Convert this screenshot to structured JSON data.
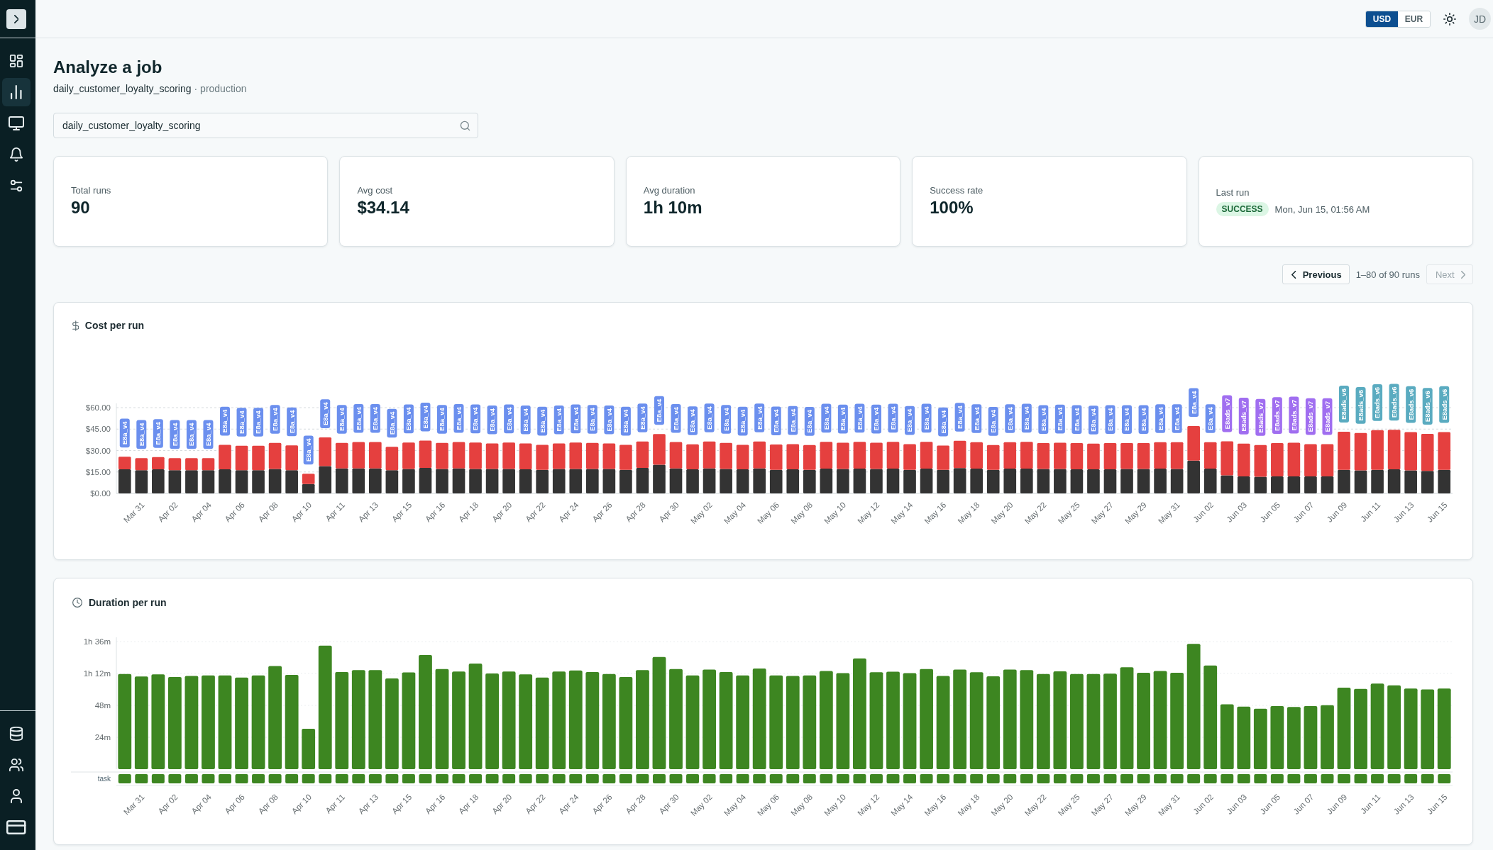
{
  "sidebar": {
    "items": [
      {
        "selected": false
      },
      {
        "selected": true
      },
      {
        "selected": false
      },
      {
        "selected": false
      },
      {
        "selected": false
      }
    ],
    "bottom_items": [
      {
        "selected": false
      },
      {
        "selected": false
      },
      {
        "selected": false
      },
      {
        "selected": false
      }
    ]
  },
  "header": {
    "currency": [
      {
        "label": "USD",
        "selected": true
      },
      {
        "label": "EUR",
        "selected": false
      }
    ],
    "avatar": "JD"
  },
  "page": {
    "title": "Analyze a job",
    "job": "daily_customer_loyalty_scoring",
    "environment": "· production"
  },
  "search": {
    "value": "daily_customer_loyalty_scoring"
  },
  "stats": [
    {
      "kind": "metric",
      "label": "Total runs",
      "value": "90"
    },
    {
      "kind": "metric",
      "label": "Avg cost",
      "value": "$34.14"
    },
    {
      "kind": "metric",
      "label": "Avg duration",
      "value": "1h 10m"
    },
    {
      "kind": "metric",
      "label": "Success rate",
      "value": "100%"
    },
    {
      "kind": "last_run",
      "label": "Last run",
      "status": "SUCCESS",
      "time": "Mon, Jun 15, 01:56 AM"
    }
  ],
  "pagination": {
    "previous": {
      "label": "Previous",
      "disabled": false
    },
    "range": "1–80 of 90 runs",
    "next": {
      "label": "Next",
      "disabled": true
    }
  },
  "cost_chart": {
    "title": "Cost per run",
    "chart_data": {
      "type": "bar",
      "stacked": true,
      "grid": true,
      "categories": [
        null,
        "Mar 31",
        null,
        "Apr 02",
        null,
        "Apr 04",
        null,
        "Apr 06",
        null,
        "Apr 08",
        null,
        "Apr 10",
        null,
        "Apr 11",
        null,
        "Apr 13",
        null,
        "Apr 15",
        null,
        "Apr 16",
        null,
        "Apr 18",
        null,
        "Apr 20",
        null,
        "Apr 22",
        null,
        "Apr 24",
        null,
        "Apr 26",
        null,
        "Apr 28",
        null,
        "Apr 30",
        null,
        "May 02",
        null,
        "May 04",
        null,
        "May 06",
        null,
        "May 08",
        null,
        "May 10",
        null,
        "May 12",
        null,
        "May 14",
        null,
        "May 16",
        null,
        "May 18",
        null,
        "May 20",
        null,
        "May 22",
        null,
        "May 25",
        null,
        "May 27",
        null,
        "May 29",
        null,
        "May 31",
        null,
        "Jun 02",
        null,
        "Jun 03",
        null,
        "Jun 05",
        null,
        "Jun 07",
        null,
        "Jun 09",
        null,
        "Jun 11",
        null,
        "Jun 13",
        null,
        "Jun 15"
      ],
      "ylim": [
        0,
        60
      ],
      "yticks": [
        {
          "value": 0,
          "label": "$0.00"
        },
        {
          "value": 15,
          "label": "$15.00"
        },
        {
          "value": 30,
          "label": "$30.00"
        },
        {
          "value": 45,
          "label": "$45.00"
        },
        {
          "value": 60,
          "label": "$60.00"
        }
      ],
      "series": [
        {
          "color": "#333333",
          "values": [
            16.8,
            16.2,
            16.8,
            16.2,
            16.2,
            16.2,
            16.8,
            16.2,
            16.2,
            17.1,
            16.2,
            6.6,
            19.1,
            17.5,
            17.5,
            17.5,
            16.2,
            17.1,
            17.8,
            17.1,
            17.5,
            17.1,
            17.1,
            17.1,
            16.8,
            16.5,
            17.1,
            17.1,
            17.1,
            17.1,
            16.5,
            17.8,
            20.1,
            17.5,
            16.8,
            17.5,
            17.1,
            16.8,
            17.5,
            16.5,
            16.8,
            16.5,
            17.4,
            17.1,
            17.4,
            17.1,
            17.4,
            16.5,
            17.4,
            16.5,
            17.7,
            17.4,
            16.5,
            17.4,
            17.4,
            17.1,
            17.1,
            16.8,
            16.8,
            16.8,
            17.1,
            17.1,
            17.4,
            17.1,
            22.9,
            17.4,
            12.6,
            11.9,
            11.6,
            11.9,
            11.9,
            11.9,
            11.9,
            16.5,
            16.1,
            16.5,
            16.8,
            16.1,
            15.8,
            16.5
          ]
        },
        {
          "color": "#e5403f",
          "values": [
            8.9,
            8.5,
            8.6,
            8.5,
            8.5,
            8.5,
            17.2,
            17.1,
            17.1,
            18.2,
            17.4,
            7.2,
            20.1,
            17.8,
            18.4,
            18.4,
            16.4,
            18.5,
            19.1,
            18.2,
            18.4,
            18.5,
            17.8,
            18.5,
            18.1,
            17.5,
            17.8,
            18.5,
            18.2,
            17.8,
            17.5,
            18.5,
            21.4,
            18.4,
            17.5,
            18.8,
            18.2,
            17.2,
            18.8,
            17.7,
            17.7,
            17.4,
            18.7,
            18.4,
            18.7,
            18.4,
            18.7,
            18,
            18.7,
            17,
            19.1,
            18.4,
            17.4,
            18.4,
            18.7,
            18.1,
            18.4,
            18.4,
            18,
            18.4,
            18.1,
            18.1,
            18.4,
            18.7,
            24.2,
            18.4,
            23.9,
            22.9,
            22.3,
            23.3,
            23.6,
            22.6,
            22.6,
            26.7,
            26.2,
            27.7,
            27.7,
            26.8,
            25.8,
            26.4
          ]
        }
      ]
    },
    "run_tags": [
      {
        "label": "E8a_v4",
        "color": "#6b8fee"
      },
      {
        "label": "E8a_v4",
        "color": "#6b8fee"
      },
      {
        "label": "E8a_v4",
        "color": "#6b8fee"
      },
      {
        "label": "E8a_v4",
        "color": "#6b8fee"
      },
      {
        "label": "E8a_v4",
        "color": "#6b8fee"
      },
      {
        "label": "E8a_v4",
        "color": "#6b8fee"
      },
      {
        "label": "E8a_v4",
        "color": "#6b8fee"
      },
      {
        "label": "E8a_v4",
        "color": "#6b8fee"
      },
      {
        "label": "E8a_v4",
        "color": "#6b8fee"
      },
      {
        "label": "E8a_v4",
        "color": "#6b8fee"
      },
      {
        "label": "E8a_v4",
        "color": "#6b8fee"
      },
      {
        "label": "E8a_v4",
        "color": "#6b8fee"
      },
      {
        "label": "E8a_v4",
        "color": "#6b8fee"
      },
      {
        "label": "E8a_v4",
        "color": "#6b8fee"
      },
      {
        "label": "E8a_v4",
        "color": "#6b8fee"
      },
      {
        "label": "E8a_v4",
        "color": "#6b8fee"
      },
      {
        "label": "E8a_v4",
        "color": "#6b8fee"
      },
      {
        "label": "E8a_v4",
        "color": "#6b8fee"
      },
      {
        "label": "E8a_v4",
        "color": "#6b8fee"
      },
      {
        "label": "E8a_v4",
        "color": "#6b8fee"
      },
      {
        "label": "E8a_v4",
        "color": "#6b8fee"
      },
      {
        "label": "E8a_v4",
        "color": "#6b8fee"
      },
      {
        "label": "E8a_v4",
        "color": "#6b8fee"
      },
      {
        "label": "E8a_v4",
        "color": "#6b8fee"
      },
      {
        "label": "E8a_v4",
        "color": "#6b8fee"
      },
      {
        "label": "E8a_v4",
        "color": "#6b8fee"
      },
      {
        "label": "E8a_v4",
        "color": "#6b8fee"
      },
      {
        "label": "E8a_v4",
        "color": "#6b8fee"
      },
      {
        "label": "E8a_v4",
        "color": "#6b8fee"
      },
      {
        "label": "E8a_v4",
        "color": "#6b8fee"
      },
      {
        "label": "E8a_v4",
        "color": "#6b8fee"
      },
      {
        "label": "E8a_v4",
        "color": "#6b8fee"
      },
      {
        "label": "E8a_v4",
        "color": "#6b8fee"
      },
      {
        "label": "E8a_v4",
        "color": "#6b8fee"
      },
      {
        "label": "E8a_v4",
        "color": "#6b8fee"
      },
      {
        "label": "E8a_v4",
        "color": "#6b8fee"
      },
      {
        "label": "E8a_v4",
        "color": "#6b8fee"
      },
      {
        "label": "E8a_v4",
        "color": "#6b8fee"
      },
      {
        "label": "E8a_v4",
        "color": "#6b8fee"
      },
      {
        "label": "E8a_v4",
        "color": "#6b8fee"
      },
      {
        "label": "E8a_v4",
        "color": "#6b8fee"
      },
      {
        "label": "E8a_v4",
        "color": "#6b8fee"
      },
      {
        "label": "E8a_v4",
        "color": "#6b8fee"
      },
      {
        "label": "E8a_v4",
        "color": "#6b8fee"
      },
      {
        "label": "E8a_v4",
        "color": "#6b8fee"
      },
      {
        "label": "E8a_v4",
        "color": "#6b8fee"
      },
      {
        "label": "E8a_v4",
        "color": "#6b8fee"
      },
      {
        "label": "E8a_v4",
        "color": "#6b8fee"
      },
      {
        "label": "E8a_v4",
        "color": "#6b8fee"
      },
      {
        "label": "E8a_v4",
        "color": "#6b8fee"
      },
      {
        "label": "E8a_v4",
        "color": "#6b8fee"
      },
      {
        "label": "E8a_v4",
        "color": "#6b8fee"
      },
      {
        "label": "E8a_v4",
        "color": "#6b8fee"
      },
      {
        "label": "E8a_v4",
        "color": "#6b8fee"
      },
      {
        "label": "E8a_v4",
        "color": "#6b8fee"
      },
      {
        "label": "E8a_v4",
        "color": "#6b8fee"
      },
      {
        "label": "E8a_v4",
        "color": "#6b8fee"
      },
      {
        "label": "E8a_v4",
        "color": "#6b8fee"
      },
      {
        "label": "E8a_v4",
        "color": "#6b8fee"
      },
      {
        "label": "E8a_v4",
        "color": "#6b8fee"
      },
      {
        "label": "E8a_v4",
        "color": "#6b8fee"
      },
      {
        "label": "E8a_v4",
        "color": "#6b8fee"
      },
      {
        "label": "E8a_v4",
        "color": "#6b8fee"
      },
      {
        "label": "E8a_v4",
        "color": "#6b8fee"
      },
      {
        "label": "E8a_v4",
        "color": "#6b8fee"
      },
      {
        "label": "E8a_v4",
        "color": "#6b8fee"
      },
      {
        "label": "E8ads_v7",
        "color": "#a06ef0"
      },
      {
        "label": "E8ads_v7",
        "color": "#a06ef0"
      },
      {
        "label": "E8ads_v7",
        "color": "#a06ef0"
      },
      {
        "label": "E8ads_v7",
        "color": "#a06ef0"
      },
      {
        "label": "E8ads_v7",
        "color": "#a06ef0"
      },
      {
        "label": "E8ads_v7",
        "color": "#a06ef0"
      },
      {
        "label": "E8ads_v7",
        "color": "#a06ef0"
      },
      {
        "label": "E8ads_v6",
        "color": "#5aabc0"
      },
      {
        "label": "E8ads_v6",
        "color": "#5aabc0"
      },
      {
        "label": "E8ads_v6",
        "color": "#5aabc0"
      },
      {
        "label": "E8ads_v6",
        "color": "#5aabc0"
      },
      {
        "label": "E8ads_v6",
        "color": "#5aabc0"
      },
      {
        "label": "E8ads_v6",
        "color": "#5aabc0"
      },
      {
        "label": "E8ads_v6",
        "color": "#5aabc0"
      }
    ]
  },
  "duration_chart": {
    "title": "Duration per run",
    "track_label": "task",
    "chart_data": {
      "type": "bar",
      "grid": true,
      "categories": [
        null,
        "Mar 31",
        null,
        "Apr 02",
        null,
        "Apr 04",
        null,
        "Apr 06",
        null,
        "Apr 08",
        null,
        "Apr 10",
        null,
        "Apr 11",
        null,
        "Apr 13",
        null,
        "Apr 15",
        null,
        "Apr 16",
        null,
        "Apr 18",
        null,
        "Apr 20",
        null,
        "Apr 22",
        null,
        "Apr 24",
        null,
        "Apr 26",
        null,
        "Apr 28",
        null,
        "Apr 30",
        null,
        "May 02",
        null,
        "May 04",
        null,
        "May 06",
        null,
        "May 08",
        null,
        "May 10",
        null,
        "May 12",
        null,
        "May 14",
        null,
        "May 16",
        null,
        "May 18",
        null,
        "May 20",
        null,
        "May 22",
        null,
        "May 25",
        null,
        "May 27",
        null,
        "May 29",
        null,
        "May 31",
        null,
        "Jun 02",
        null,
        "Jun 03",
        null,
        "Jun 05",
        null,
        "Jun 07",
        null,
        "Jun 09",
        null,
        "Jun 11",
        null,
        "Jun 13",
        null,
        "Jun 15"
      ],
      "ylim": [
        0,
        96
      ],
      "yticks": [
        {
          "value": 24,
          "label": "24m"
        },
        {
          "value": 48,
          "label": "48m"
        },
        {
          "value": 72,
          "label": "1h 12m"
        },
        {
          "value": 96,
          "label": "1h 36m"
        }
      ],
      "series": [
        {
          "color": "#3d8621",
          "values": [
            71.6,
            69.8,
            71.3,
            69.4,
            70.1,
            70.5,
            70.5,
            69,
            70.5,
            77.6,
            70.9,
            30.4,
            93,
            73.1,
            74.6,
            74.6,
            68.3,
            72.8,
            85.9,
            75.4,
            73.5,
            79.5,
            72,
            73.5,
            71.3,
            69,
            73.5,
            74.3,
            73.1,
            71.6,
            69.4,
            74.6,
            84.4,
            75.4,
            70.5,
            75,
            73.1,
            70.5,
            75.8,
            70.6,
            70.2,
            70.6,
            73.9,
            72.3,
            83.4,
            72.9,
            73.3,
            72.3,
            75.3,
            70.2,
            75,
            72.9,
            69.9,
            75,
            74.6,
            71.6,
            73.6,
            71.6,
            71.6,
            71.9,
            76.7,
            72.6,
            73.9,
            72.6,
            94.3,
            78,
            48.8,
            47.1,
            45.5,
            47.5,
            46.8,
            47.5,
            48.2,
            61.4,
            60.4,
            64.4,
            63.1,
            60.7,
            60,
            60.7
          ]
        }
      ]
    }
  }
}
